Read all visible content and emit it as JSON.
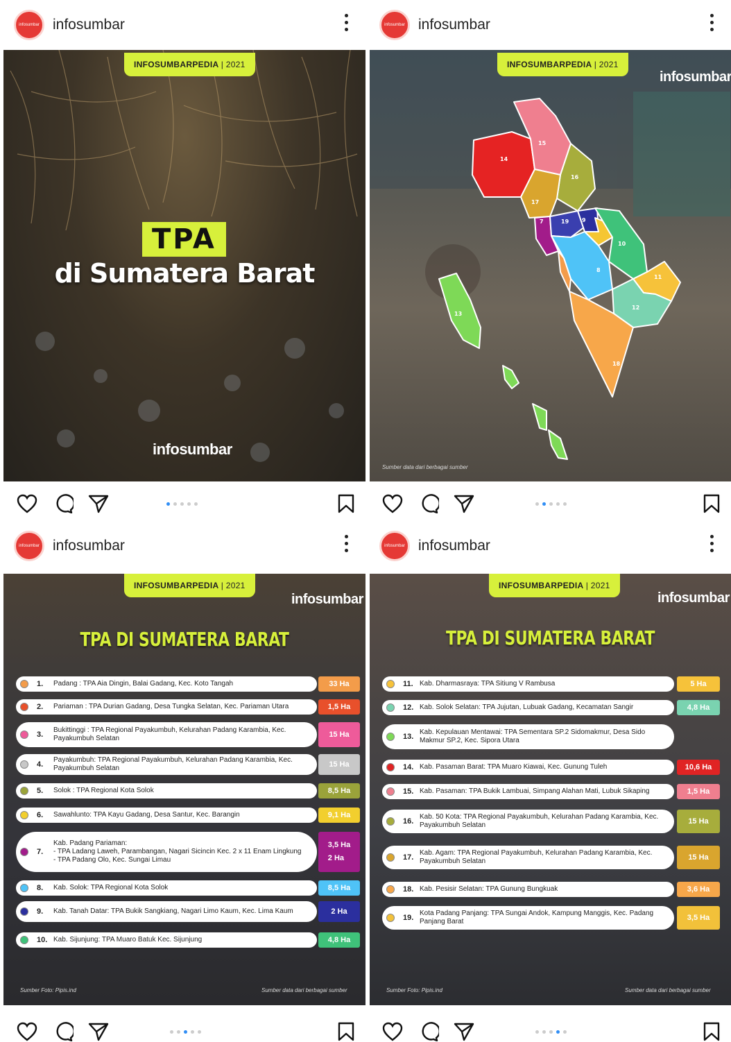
{
  "account": "infosumbar",
  "avatar_text": "infosumbar",
  "badge": {
    "name": "INFOSUMBARPEDIA",
    "sep": "|",
    "year": "2021"
  },
  "brand": "infosumbar",
  "source_data": "Sumber data dari berbagai sumber",
  "source_photo": "Sumber Foto: Pipis.ind",
  "post1": {
    "tag": "TPA",
    "subtitle": "di Sumatera Barat"
  },
  "list_title": "TPA DI SUMATERA BARAT",
  "map_regions": [
    "14",
    "15",
    "16",
    "17",
    "7",
    "19",
    "9",
    "10",
    "8",
    "11",
    "12",
    "18",
    "13"
  ],
  "icons": {
    "like": "heart-icon",
    "comment": "comment-icon",
    "share": "send-icon",
    "save": "bookmark-icon",
    "more": "more-vertical-icon"
  },
  "list1": [
    {
      "n": "1.",
      "text": "Padang : TPA Aia Dingin, Balai Gadang, Kec. Koto Tangah",
      "ha": "33 Ha",
      "dot": "#f39c4a",
      "col": "#f39c4a"
    },
    {
      "n": "2.",
      "text": "Pariaman : TPA Durian Gadang, Desa Tungka Selatan, Kec. Pariaman Utara",
      "ha": "1,5 Ha",
      "dot": "#e8502b",
      "col": "#e8502b"
    },
    {
      "n": "3.",
      "text": "Bukittinggi : TPA Regional Payakumbuh, Kelurahan Padang Karambia, Kec. Payakumbuh Selatan",
      "ha": "15 Ha",
      "dot": "#ee5b9a",
      "col": "#ee5b9a"
    },
    {
      "n": "4.",
      "text": "Payakumbuh: TPA Regional Payakumbuh, Kelurahan Padang Karambia, Kec. Payakumbuh Selatan",
      "ha": "15 Ha",
      "dot": "#c8c8c8",
      "col": "#c8c8c8"
    },
    {
      "n": "5.",
      "text": "Solok : TPA Regional Kota Solok",
      "ha": "8,5 Ha",
      "dot": "#9aa33a",
      "col": "#9aa33a"
    },
    {
      "n": "6.",
      "text": "Sawahlunto: TPA Kayu Gadang, Desa Santur, Kec. Barangin",
      "ha": "9,1 Ha",
      "dot": "#f2cf2e",
      "col": "#f2cf2e"
    },
    {
      "n": "7.",
      "text": "Kab. Padang Pariaman:\n- TPA Ladang Laweh, Parambangan, Nagari Sicincin Kec. 2 x 11 Enam Lingkung\n- TPA Padang Olo, Kec. Sungai Limau",
      "ha": "3,5 Ha\n2 Ha",
      "dot": "#a21c8a",
      "col": "#a21c8a"
    },
    {
      "n": "8.",
      "text": "Kab. Solok: TPA Regional Kota Solok",
      "ha": "8,5 Ha",
      "dot": "#4fc3f7",
      "col": "#4fc3f7"
    },
    {
      "n": "9.",
      "text": "Kab. Tanah Datar: TPA Bukik Sangkiang, Nagari Limo Kaum, Kec. Lima Kaum",
      "ha": "2 Ha",
      "dot": "#2b2f9e",
      "col": "#2b2f9e"
    },
    {
      "n": "10.",
      "text": "Kab. Sijunjung: TPA Muaro Batuk Kec. Sijunjung",
      "ha": "4,8 Ha",
      "dot": "#3fc27a",
      "col": "#3fc27a"
    }
  ],
  "list2": [
    {
      "n": "11.",
      "text": "Kab. Dharmasraya: TPA Sitiung V Rambusa",
      "ha": "5 Ha",
      "dot": "#f6c23a",
      "col": "#f6c23a"
    },
    {
      "n": "12.",
      "text": "Kab. Solok Selatan: TPA Jujutan, Lubuak Gadang, Kecamatan Sangir",
      "ha": "4,8 Ha",
      "dot": "#7ad3b0",
      "col": "#7ad3b0"
    },
    {
      "n": "13.",
      "text": "Kab. Kepulauan Mentawai: TPA Sementara SP.2 Sidomakmur, Desa Sido Makmur SP.2, Kec. Sipora Utara",
      "ha": "",
      "dot": "#7ed957",
      "col": ""
    },
    {
      "n": "14.",
      "text": "Kab. Pasaman Barat: TPA Muaro Kiawai, Kec. Gunung Tuleh",
      "ha": "10,6 Ha",
      "dot": "#e02424",
      "col": "#e02424"
    },
    {
      "n": "15.",
      "text": "Kab. Pasaman: TPA Bukik Lambuai, Simpang Alahan Mati, Lubuk Sikaping",
      "ha": "1,5 Ha",
      "dot": "#ef7f8f",
      "col": "#ef7f8f"
    },
    {
      "n": "16.",
      "text": "Kab. 50 Kota: TPA Regional Payakumbuh, Kelurahan Padang Karambia, Kec. Payakumbuh Selatan",
      "ha": "15 Ha",
      "dot": "#a7ad3c",
      "col": "#a7ad3c"
    },
    {
      "n": "17.",
      "text": "Kab. Agam: TPA Regional Payakumbuh, Kelurahan Padang Karambia, Kec. Payakumbuh Selatan",
      "ha": "15 Ha",
      "dot": "#d9a52e",
      "col": "#d9a52e"
    },
    {
      "n": "18.",
      "text": "Kab. Pesisir Selatan: TPA Gunung Bungkuak",
      "ha": "3,6 Ha",
      "dot": "#f7a74a",
      "col": "#f7a74a"
    },
    {
      "n": "19.",
      "text": "Kota Padang Panjang: TPA Sungai Andok, Kampung Manggis, Kec. Padang Panjang Barat",
      "ha": "3,5 Ha",
      "dot": "#f2c13a",
      "col": "#f2c13a"
    }
  ]
}
